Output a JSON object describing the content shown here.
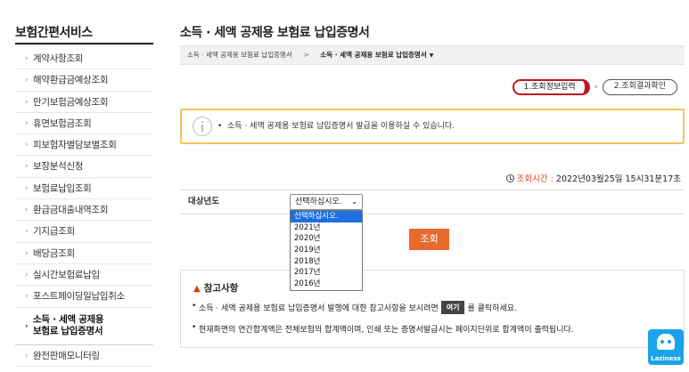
{
  "sidebar": {
    "title": "보험간편서비스",
    "items": [
      {
        "label": "계약사항조회"
      },
      {
        "label": "해약환급금예상조회"
      },
      {
        "label": "만기보험금예상조회"
      },
      {
        "label": "휴면보험금조회"
      },
      {
        "label": "피보험자별담보별조회"
      },
      {
        "label": "보장분석신청"
      },
      {
        "label": "보험료납입조회"
      },
      {
        "label": "환급금대출내역조회"
      },
      {
        "label": "기지급조회"
      },
      {
        "label": "배당금조회"
      },
      {
        "label": "실시간보험료납입"
      },
      {
        "label": "포스트페이딩일납입취소"
      }
    ],
    "active_line1": "소득 · 세액 공제용",
    "active_line2": "보험료 납입증명서",
    "last_item": "완전판매모니터링"
  },
  "page": {
    "title": "소득 · 세액 공제용 보험료 납입증명서"
  },
  "breadcrumb": {
    "parent": "소득 · 세액 공제용 보험료 납입증명서",
    "current": "소득 · 세액 공제용 보험료 납입증명서"
  },
  "steps": {
    "step1": "1.조회정보입력",
    "step2": "2.조회결과확인"
  },
  "notice": {
    "text": "소득 · 세액 공제용 보험료 납입증명서 발급을 이용하실 수 있습니다."
  },
  "query_time": {
    "label": "조회시간 :",
    "value": "2022년03월25일 15시31분17초"
  },
  "form": {
    "year_label": "대상년도",
    "selected": "선택하십시오.",
    "options": [
      "선택하십시오.",
      "2021년",
      "2020년",
      "2019년",
      "2018년",
      "2017년",
      "2016년"
    ]
  },
  "search_button": "조회",
  "reference": {
    "title": "참고사항",
    "line1_before": "소득 · 세액 공제용 보험료 납입증명서 발행에 대한 참고사항을 보시려면",
    "here_button": "여기",
    "line1_after": "를 클릭하세요.",
    "line2": "현재화면의 연간합계액은 전체보험의 합계액이며, 인쇄 또는 증명서발급시는 페이지단위로 합계액이 출력됩니다."
  },
  "widget": {
    "label": "Laziness"
  },
  "colors": {
    "accent_orange": "#e86b2d",
    "step_red": "#c0161d",
    "notice_border": "#f0c65a",
    "selected_option": "#1e6fe0"
  }
}
